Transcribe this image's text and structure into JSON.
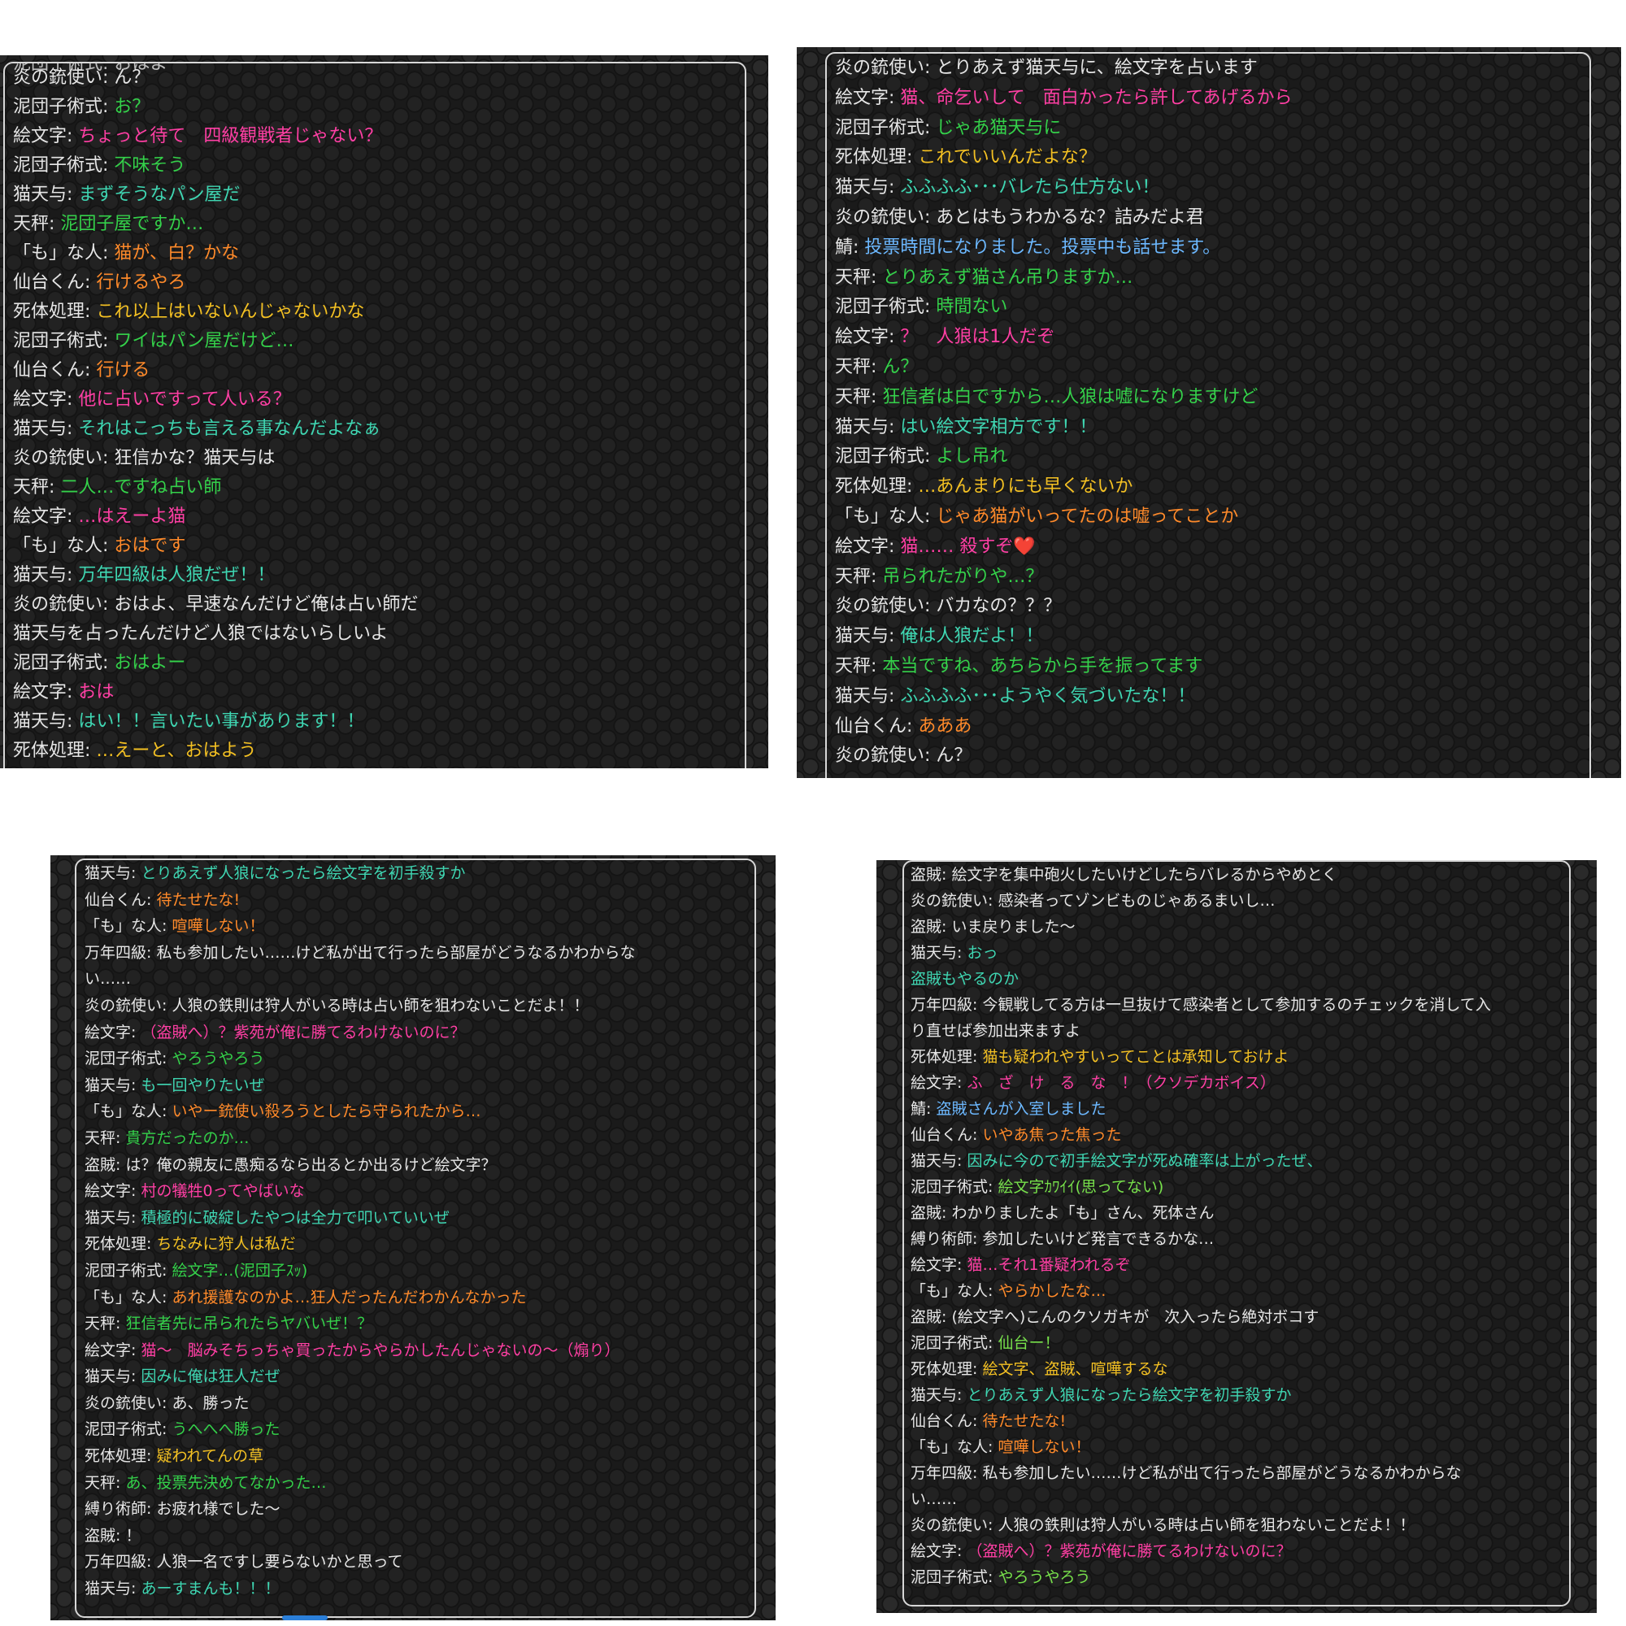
{
  "colors": {
    "default": "#e6e6e6",
    "pink": "#ff3fa4",
    "green": "#34d14a",
    "teal": "#3fd6b2",
    "orange": "#ff8a2a",
    "yellow": "#f3c023",
    "blue": "#6cb8ff",
    "lime": "#77e04b",
    "salmon": "#ff8a6a"
  },
  "panels": [
    {
      "id": "p1",
      "topcut": "泥団子術式: おはよー",
      "messages": [
        {
          "speaker": "炎の銃使い",
          "text": "ん？",
          "color": "default"
        },
        {
          "speaker": "泥団子術式",
          "text": "お？",
          "color": "green"
        },
        {
          "speaker": "絵文字",
          "text": "ちょっと待て　四級観戦者じゃない？",
          "color": "pink"
        },
        {
          "speaker": "泥団子術式",
          "text": "不味そう",
          "color": "green"
        },
        {
          "speaker": "猫天与",
          "text": "まずそうなパン屋だ",
          "color": "teal"
        },
        {
          "speaker": "天秤",
          "text": "泥団子屋ですか…",
          "color": "green"
        },
        {
          "speaker": "「も」な人",
          "text": "猫が、白？かな",
          "color": "orange"
        },
        {
          "speaker": "仙台くん",
          "text": "行けるやろ",
          "color": "orange"
        },
        {
          "speaker": "死体処理",
          "text": "これ以上はいないんじゃないかな",
          "color": "yellow"
        },
        {
          "speaker": "泥団子術式",
          "text": "ワイはパン屋だけど…",
          "color": "green"
        },
        {
          "speaker": "仙台くん",
          "text": "行ける",
          "color": "orange"
        },
        {
          "speaker": "絵文字",
          "text": "他に占いですって人いる？",
          "color": "pink"
        },
        {
          "speaker": "猫天与",
          "text": "それはこっちも言える事なんだよなぁ",
          "color": "teal"
        },
        {
          "speaker": "炎の銃使い",
          "text": "狂信かな？猫天与は",
          "color": "default"
        },
        {
          "speaker": "天秤",
          "text": "二人…ですね占い師",
          "color": "green"
        },
        {
          "speaker": "絵文字",
          "text": "…はえーよ猫",
          "color": "pink"
        },
        {
          "speaker": "「も」な人",
          "text": "おはです",
          "color": "orange"
        },
        {
          "speaker": "猫天与",
          "text": "万年四級は人狼だぜ！！",
          "color": "teal"
        },
        {
          "speaker": "炎の銃使い",
          "text": "おはよ、早速なんだけど俺は占い師だ",
          "color": "default"
        },
        {
          "speaker": "",
          "text": "猫天与を占ったんだけど人狼ではないらしいよ",
          "color": "default"
        },
        {
          "speaker": "泥団子術式",
          "text": "おはよー",
          "color": "green"
        },
        {
          "speaker": "絵文字",
          "text": "おは",
          "color": "pink"
        },
        {
          "speaker": "猫天与",
          "text": "はい！！言いたい事があります！！",
          "color": "teal"
        },
        {
          "speaker": "死体処理",
          "text": "…えーと、おはよう",
          "color": "yellow"
        }
      ]
    },
    {
      "id": "p2",
      "messages": [
        {
          "speaker": "炎の銃使い",
          "text": "とりあえず猫天与に、絵文字を占います",
          "color": "default"
        },
        {
          "speaker": "絵文字",
          "text": "猫、命乞いして　面白かったら許してあげるから",
          "color": "pink"
        },
        {
          "speaker": "泥団子術式",
          "text": "じゃあ猫天与に",
          "color": "green"
        },
        {
          "speaker": "死体処理",
          "text": "これでいいんだよな？",
          "color": "yellow"
        },
        {
          "speaker": "猫天与",
          "text": "ふふふふ･･･バレたら仕方ない！",
          "color": "teal"
        },
        {
          "speaker": "炎の銃使い",
          "text": "あとはもうわかるな？詰みだよ君",
          "color": "default"
        },
        {
          "speaker": "鯖",
          "text": "投票時間になりました。投票中も話せます。",
          "color": "blue"
        },
        {
          "speaker": "天秤",
          "text": "とりあえず猫さん吊りますか…",
          "color": "green"
        },
        {
          "speaker": "泥団子術式",
          "text": "時間ない",
          "color": "green"
        },
        {
          "speaker": "絵文字",
          "text": "？　人狼は1人だぞ",
          "color": "pink"
        },
        {
          "speaker": "天秤",
          "text": "ん？",
          "color": "green"
        },
        {
          "speaker": "天秤",
          "text": "狂信者は白ですから…人狼は嘘になりますけど",
          "color": "green"
        },
        {
          "speaker": "猫天与",
          "text": "はい絵文字相方です！！",
          "color": "teal"
        },
        {
          "speaker": "泥団子術式",
          "text": "よし吊れ",
          "color": "green"
        },
        {
          "speaker": "死体処理",
          "text": "…あんまりにも早くないか",
          "color": "yellow"
        },
        {
          "speaker": "「も」な人",
          "text": "じゃあ猫がいってたのは嘘ってことか",
          "color": "orange"
        },
        {
          "speaker": "絵文字",
          "text": "猫…… 殺すぞ❤️",
          "color": "pink"
        },
        {
          "speaker": "天秤",
          "text": "吊られたがりや…？",
          "color": "green"
        },
        {
          "speaker": "炎の銃使い",
          "text": "バカなの？？？",
          "color": "default"
        },
        {
          "speaker": "猫天与",
          "text": "俺は人狼だよ！！",
          "color": "teal"
        },
        {
          "speaker": "天秤",
          "text": "本当ですね、あちらから手を振ってます",
          "color": "green"
        },
        {
          "speaker": "猫天与",
          "text": "ふふふふ･･･ようやく気づいたな！！",
          "color": "teal"
        },
        {
          "speaker": "仙台くん",
          "text": "あああ",
          "color": "orange"
        },
        {
          "speaker": "炎の銃使い",
          "text": "ん？",
          "color": "default"
        }
      ]
    },
    {
      "id": "p3",
      "messages": [
        {
          "speaker": "猫天与",
          "text": "とりあえず人狼になったら絵文字を初手殺すか",
          "color": "teal"
        },
        {
          "speaker": "仙台くん",
          "text": "待たせたな!",
          "color": "orange"
        },
        {
          "speaker": "「も」な人",
          "text": "喧嘩しない！",
          "color": "orange"
        },
        {
          "speaker": "万年四級",
          "text": "私も参加したい……けど私が出て行ったら部屋がどうなるかわからな\nい……",
          "color": "default"
        },
        {
          "speaker": "炎の銃使い",
          "text": "人狼の鉄則は狩人がいる時は占い師を狙わないことだよ！！",
          "color": "default"
        },
        {
          "speaker": "絵文字",
          "text": "（盗賊へ）？紫苑が俺に勝てるわけないのに？",
          "color": "pink"
        },
        {
          "speaker": "泥団子術式",
          "text": "やろうやろう",
          "color": "green"
        },
        {
          "speaker": "猫天与",
          "text": "も一回やりたいぜ",
          "color": "teal"
        },
        {
          "speaker": "「も」な人",
          "text": "いやー銃使い殺ろうとしたら守られたから…",
          "color": "orange"
        },
        {
          "speaker": "天秤",
          "text": "貴方だったのか…",
          "color": "green"
        },
        {
          "speaker": "盗賊",
          "text": "は？俺の親友に愚痴るなら出るとか出るけど絵文字？",
          "color": "default"
        },
        {
          "speaker": "絵文字",
          "text": "村の犠牲0ってやばいな",
          "color": "pink"
        },
        {
          "speaker": "猫天与",
          "text": "積極的に破綻したやつは全力で叩いていいぜ",
          "color": "teal"
        },
        {
          "speaker": "死体処理",
          "text": "ちなみに狩人は私だ",
          "color": "yellow"
        },
        {
          "speaker": "泥団子術式",
          "text": "絵文字…(泥団子ｽｯ)",
          "color": "green"
        },
        {
          "speaker": "「も」な人",
          "text": "あれ援護なのかよ…狂人だったんだわかんなかった",
          "color": "orange"
        },
        {
          "speaker": "天秤",
          "text": "狂信者先に吊られたらヤバいぜ！？",
          "color": "green"
        },
        {
          "speaker": "絵文字",
          "text": "猫〜　脳みそちっちゃ買ったからやらかしたんじゃないの〜（煽り）",
          "color": "pink"
        },
        {
          "speaker": "猫天与",
          "text": "因みに俺は狂人だぜ",
          "color": "teal"
        },
        {
          "speaker": "炎の銃使い",
          "text": "あ、勝った",
          "color": "default"
        },
        {
          "speaker": "泥団子術式",
          "text": "うへへへ勝った",
          "color": "green"
        },
        {
          "speaker": "死体処理",
          "text": "疑われてんの草",
          "color": "yellow"
        },
        {
          "speaker": "天秤",
          "text": "あ、投票先決めてなかった…",
          "color": "green"
        },
        {
          "speaker": "縛り術師",
          "text": "お疲れ様でした〜",
          "color": "default"
        },
        {
          "speaker": "盗賊",
          "text": "！",
          "color": "default"
        },
        {
          "speaker": "万年四級",
          "text": "人狼一名ですし要らないかと思って",
          "color": "default"
        },
        {
          "speaker": "猫天与",
          "text": "あーすまんも！！！",
          "color": "teal"
        }
      ]
    },
    {
      "id": "p4",
      "messages": [
        {
          "speaker": "盗賊",
          "text": "絵文字を集中砲火したいけどしたらバレるからやめとく",
          "color": "default"
        },
        {
          "speaker": "炎の銃使い",
          "text": "感染者ってゾンビものじゃあるまいし…",
          "color": "default"
        },
        {
          "speaker": "盗賊",
          "text": "いま戻りました〜",
          "color": "default"
        },
        {
          "speaker": "猫天与",
          "text": "おっ",
          "color": "teal"
        },
        {
          "speaker": "",
          "text": "盗賊もやるのか",
          "color": "teal"
        },
        {
          "speaker": "万年四級",
          "text": "今観戦してる方は一旦抜けて感染者として参加するのチェックを消して入\nり直せば参加出来ますよ",
          "color": "default"
        },
        {
          "speaker": "死体処理",
          "text": "猫も疑われやすいってことは承知しておけよ",
          "color": "yellow"
        },
        {
          "speaker": "絵文字",
          "text": "ふ　ざ　け　る　な　！（クソデカボイス）",
          "color": "pink"
        },
        {
          "speaker": "鯖",
          "text": "盗賊さんが入室しました",
          "color": "blue"
        },
        {
          "speaker": "仙台くん",
          "text": "いやあ焦った焦った",
          "color": "orange"
        },
        {
          "speaker": "猫天与",
          "text": "因みに今ので初手絵文字が死ぬ確率は上がったぜ、",
          "color": "teal"
        },
        {
          "speaker": "泥団子術式",
          "text": "絵文字ｶﾜｲｲ(思ってない)",
          "color": "lime"
        },
        {
          "speaker": "盗賊",
          "text": "わかりましたよ「も」さん、死体さん",
          "color": "default"
        },
        {
          "speaker": "縛り術師",
          "text": "参加したいけど発言できるかな…",
          "color": "default"
        },
        {
          "speaker": "絵文字",
          "text": "猫…それ1番疑われるぞ",
          "color": "pink"
        },
        {
          "speaker": "「も」な人",
          "text": "やらかしたな…",
          "color": "orange"
        },
        {
          "speaker": "盗賊",
          "text": "(絵文字へ)こんのクソガキが　次入ったら絶対ボコす",
          "color": "default"
        },
        {
          "speaker": "泥団子術式",
          "text": "仙台ー！",
          "color": "lime"
        },
        {
          "speaker": "死体処理",
          "text": "絵文字、盗賊、喧嘩するな",
          "color": "yellow"
        },
        {
          "speaker": "猫天与",
          "text": "とりあえず人狼になったら絵文字を初手殺すか",
          "color": "teal"
        },
        {
          "speaker": "仙台くん",
          "text": "待たせたな!",
          "color": "orange"
        },
        {
          "speaker": "「も」な人",
          "text": "喧嘩しない！",
          "color": "orange"
        },
        {
          "speaker": "万年四級",
          "text": "私も参加したい……けど私が出て行ったら部屋がどうなるかわからな\nい……",
          "color": "default"
        },
        {
          "speaker": "炎の銃使い",
          "text": "人狼の鉄則は狩人がいる時は占い師を狙わないことだよ！！",
          "color": "default"
        },
        {
          "speaker": "絵文字",
          "text": "（盗賊へ）？紫苑が俺に勝てるわけないのに？",
          "color": "pink"
        },
        {
          "speaker": "泥団子術式",
          "text": "やろうやろう",
          "color": "lime"
        }
      ]
    }
  ]
}
